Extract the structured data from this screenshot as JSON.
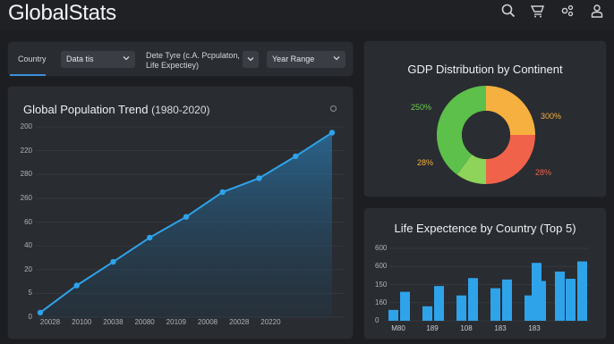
{
  "app": {
    "title": "GlobalStats"
  },
  "topbar": {
    "icons": [
      "search-icon",
      "cart-icon",
      "settings-icon",
      "user-icon"
    ]
  },
  "filters": {
    "country_label": "Country",
    "data_select": "Data tis",
    "type_label_line1": "Dete Tyre (c.A. Pcpulaton,",
    "type_label_line2": "Life Expectiey)",
    "year_select": "Year Range"
  },
  "population": {
    "title": "Global Population Trend",
    "years": "(1980-2020)",
    "y_ticks": [
      "200",
      "220",
      "280",
      "260",
      "60",
      "40",
      "20",
      "5",
      "0"
    ],
    "x_ticks": [
      "20028",
      "20100",
      "20038",
      "20080",
      "20109",
      "20008",
      "20028",
      "20220"
    ]
  },
  "gdp": {
    "title": "GDP Distribution by Continent",
    "labels": {
      "green": "250%",
      "orange_right": "300%",
      "orange_left": "28%",
      "red": "28%"
    }
  },
  "life": {
    "title": "Life Expectence by Country (Top 5)",
    "y_ticks": [
      "600",
      "600",
      "150",
      "160",
      "0"
    ],
    "x_ticks": [
      "M80",
      "189",
      "108",
      "183",
      "183"
    ]
  },
  "colors": {
    "accent_blue": "#2ea3ea",
    "pie_green": "#5cc04a",
    "pie_orange": "#f6b040",
    "pie_red": "#f0634a"
  },
  "chart_data": [
    {
      "type": "area",
      "title": "Global Population Trend (1980-2020)",
      "x": [
        "20028",
        "20100",
        "20038",
        "20080",
        "20109",
        "20008",
        "20028",
        "20220"
      ],
      "values": [
        8,
        55,
        96,
        138,
        174,
        217,
        241,
        279,
        320
      ],
      "ylim": [
        0,
        330
      ],
      "grid": true
    },
    {
      "type": "pie",
      "title": "GDP Distribution by Continent",
      "slices": [
        {
          "label": "300%",
          "value": 25,
          "color": "#f6b040"
        },
        {
          "label": "28%",
          "value": 25,
          "color": "#f0634a"
        },
        {
          "label": "28%",
          "value": 10,
          "color": "#8ed35a"
        },
        {
          "label": "250%",
          "value": 40,
          "color": "#5cc04a"
        }
      ],
      "donut": true
    },
    {
      "type": "bar",
      "title": "Life Expectence by Country (Top 5)",
      "categories": [
        "M80",
        "189",
        "108",
        "183",
        "183"
      ],
      "series": [
        {
          "values": [
            15,
            20,
            35,
            45,
            35
          ]
        },
        {
          "values": [
            40,
            48,
            59,
            57,
            55
          ]
        }
      ],
      "extra": [
        80,
        68
      ],
      "ylim": [
        0,
        100
      ],
      "grid": true
    }
  ]
}
